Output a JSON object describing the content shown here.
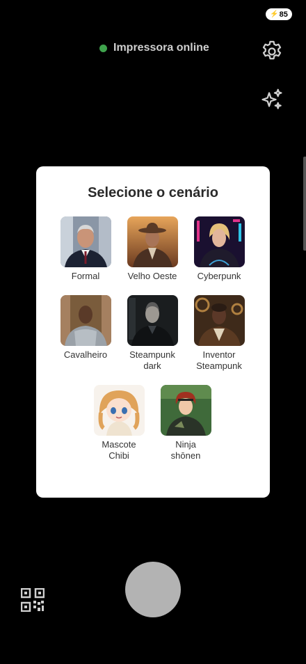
{
  "status_bar": {
    "battery": "85",
    "battery_icon": "bolt-icon"
  },
  "printer": {
    "status_text": "Impressora online",
    "dot_color": "#3fa34d"
  },
  "toolbar": {
    "settings_icon": "gear-icon",
    "effects_icon": "sparkle-icon"
  },
  "modal": {
    "title": "Selecione o cenário",
    "scenarios": [
      {
        "label": "Formal"
      },
      {
        "label": "Velho Oeste"
      },
      {
        "label": "Cyberpunk"
      },
      {
        "label": "Cavalheiro"
      },
      {
        "label": "Steampunk\ndark"
      },
      {
        "label": "Inventor\nSteampunk"
      },
      {
        "label": "Mascote\nChibi"
      },
      {
        "label": "Ninja\nshōnen"
      }
    ]
  },
  "bottom": {
    "capture_icon": "shutter-button",
    "qr_icon": "qr-code-icon"
  }
}
